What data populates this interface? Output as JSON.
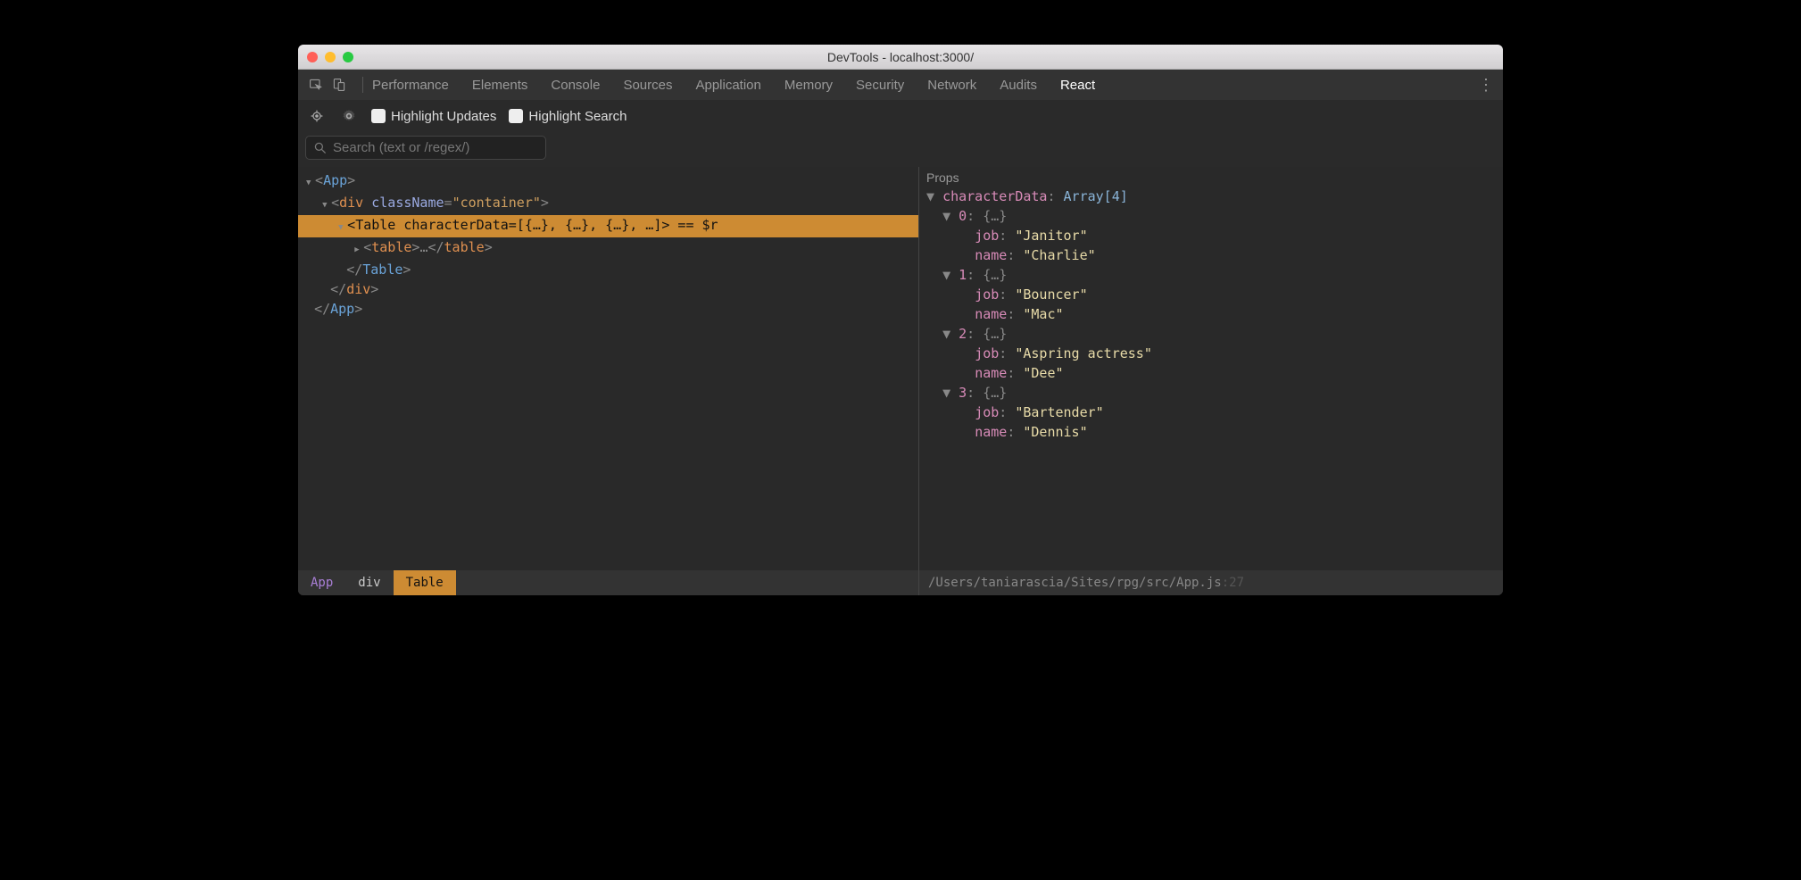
{
  "window": {
    "title": "DevTools - localhost:3000/"
  },
  "tabs": [
    "Performance",
    "Elements",
    "Console",
    "Sources",
    "Application",
    "Memory",
    "Security",
    "Network",
    "Audits",
    "React"
  ],
  "activeTab": "React",
  "toolbar": {
    "highlightUpdates": "Highlight Updates",
    "highlightSearch": "Highlight Search",
    "searchPlaceholder": "Search (text or /regex/)"
  },
  "tree": {
    "l0": {
      "open": "<",
      "tag": "App",
      "close": ">"
    },
    "l1": {
      "open": "<",
      "el": "div",
      "sp": " ",
      "attr": "className",
      "eq": "=",
      "q": "\"",
      "val": "container",
      "close": ">"
    },
    "l2": {
      "open": "<",
      "tag": "Table",
      "sp": " ",
      "attr": "characterData",
      "eq": "=",
      "arr": "[{…}, {…}, {…}, …]",
      "close": ">",
      "suffix": " == $r"
    },
    "l3": {
      "open": "<",
      "el": "table",
      "close": ">",
      "mid": "…",
      "open2": "</",
      "close2": ">"
    },
    "l4": {
      "open": "</",
      "tag": "Table",
      "close": ">"
    },
    "l5": {
      "open": "</",
      "el": "div",
      "close": ">"
    },
    "l6": {
      "open": "</",
      "tag": "App",
      "close": ">"
    }
  },
  "breadcrumb": [
    "App",
    "div",
    "Table"
  ],
  "props": {
    "title": "Props",
    "root": {
      "key": "characterData",
      "type": "Array[4]"
    },
    "items": [
      {
        "idx": "0",
        "obj": "{…}",
        "job": "\"Janitor\"",
        "name": "\"Charlie\""
      },
      {
        "idx": "1",
        "obj": "{…}",
        "job": "\"Bouncer\"",
        "name": "\"Mac\""
      },
      {
        "idx": "2",
        "obj": "{…}",
        "job": "\"Aspring actress\"",
        "name": "\"Dee\""
      },
      {
        "idx": "3",
        "obj": "{…}",
        "job": "\"Bartender\"",
        "name": "\"Dennis\""
      }
    ],
    "labels": {
      "job": "job",
      "name": "name"
    }
  },
  "sourcePath": {
    "path": "/Users/taniarascia/Sites/rpg/src/App.js",
    "line": ":27"
  }
}
